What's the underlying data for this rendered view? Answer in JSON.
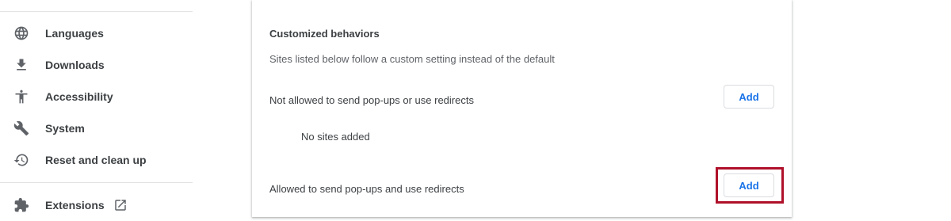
{
  "sidebar": {
    "items": [
      {
        "label": "Languages",
        "icon": "globe-icon"
      },
      {
        "label": "Downloads",
        "icon": "download-icon"
      },
      {
        "label": "Accessibility",
        "icon": "accessibility-icon"
      },
      {
        "label": "System",
        "icon": "wrench-icon"
      },
      {
        "label": "Reset and clean up",
        "icon": "restore-icon"
      }
    ],
    "extensions": {
      "label": "Extensions",
      "icon": "puzzle-icon",
      "external_icon": "open-in-new-icon"
    }
  },
  "main": {
    "section_title": "Customized behaviors",
    "section_description": "Sites listed below follow a custom setting instead of the default",
    "blocked": {
      "label": "Not allowed to send pop-ups or use redirects",
      "add_label": "Add",
      "empty_text": "No sites added"
    },
    "allowed": {
      "label": "Allowed to send pop-ups and use redirects",
      "add_label": "Add"
    }
  },
  "colors": {
    "accent": "#1a73e8",
    "highlight": "#b0102a"
  }
}
